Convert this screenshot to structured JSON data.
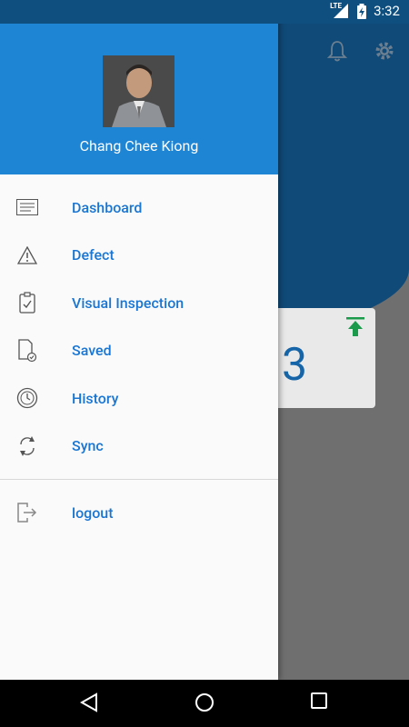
{
  "status_bar": {
    "network": "LTE",
    "time": "3:32"
  },
  "drawer": {
    "user_name": "Chang Chee Kiong",
    "items": [
      {
        "label": "Dashboard",
        "icon": "dashboard-icon"
      },
      {
        "label": "Defect",
        "icon": "warning-icon"
      },
      {
        "label": "Visual Inspection",
        "icon": "clipboard-check-icon"
      },
      {
        "label": "Saved",
        "icon": "saved-document-icon"
      },
      {
        "label": "History",
        "icon": "history-icon"
      },
      {
        "label": "Sync",
        "icon": "sync-icon"
      }
    ],
    "footer_items": [
      {
        "label": "logout",
        "icon": "logout-icon"
      }
    ]
  },
  "background": {
    "card_value": "3"
  },
  "colors": {
    "drawer_header": "#1e84d4",
    "menu_label": "#1976d2",
    "app_header": "#0f4a78",
    "upload_icon": "#1a9a4a"
  }
}
